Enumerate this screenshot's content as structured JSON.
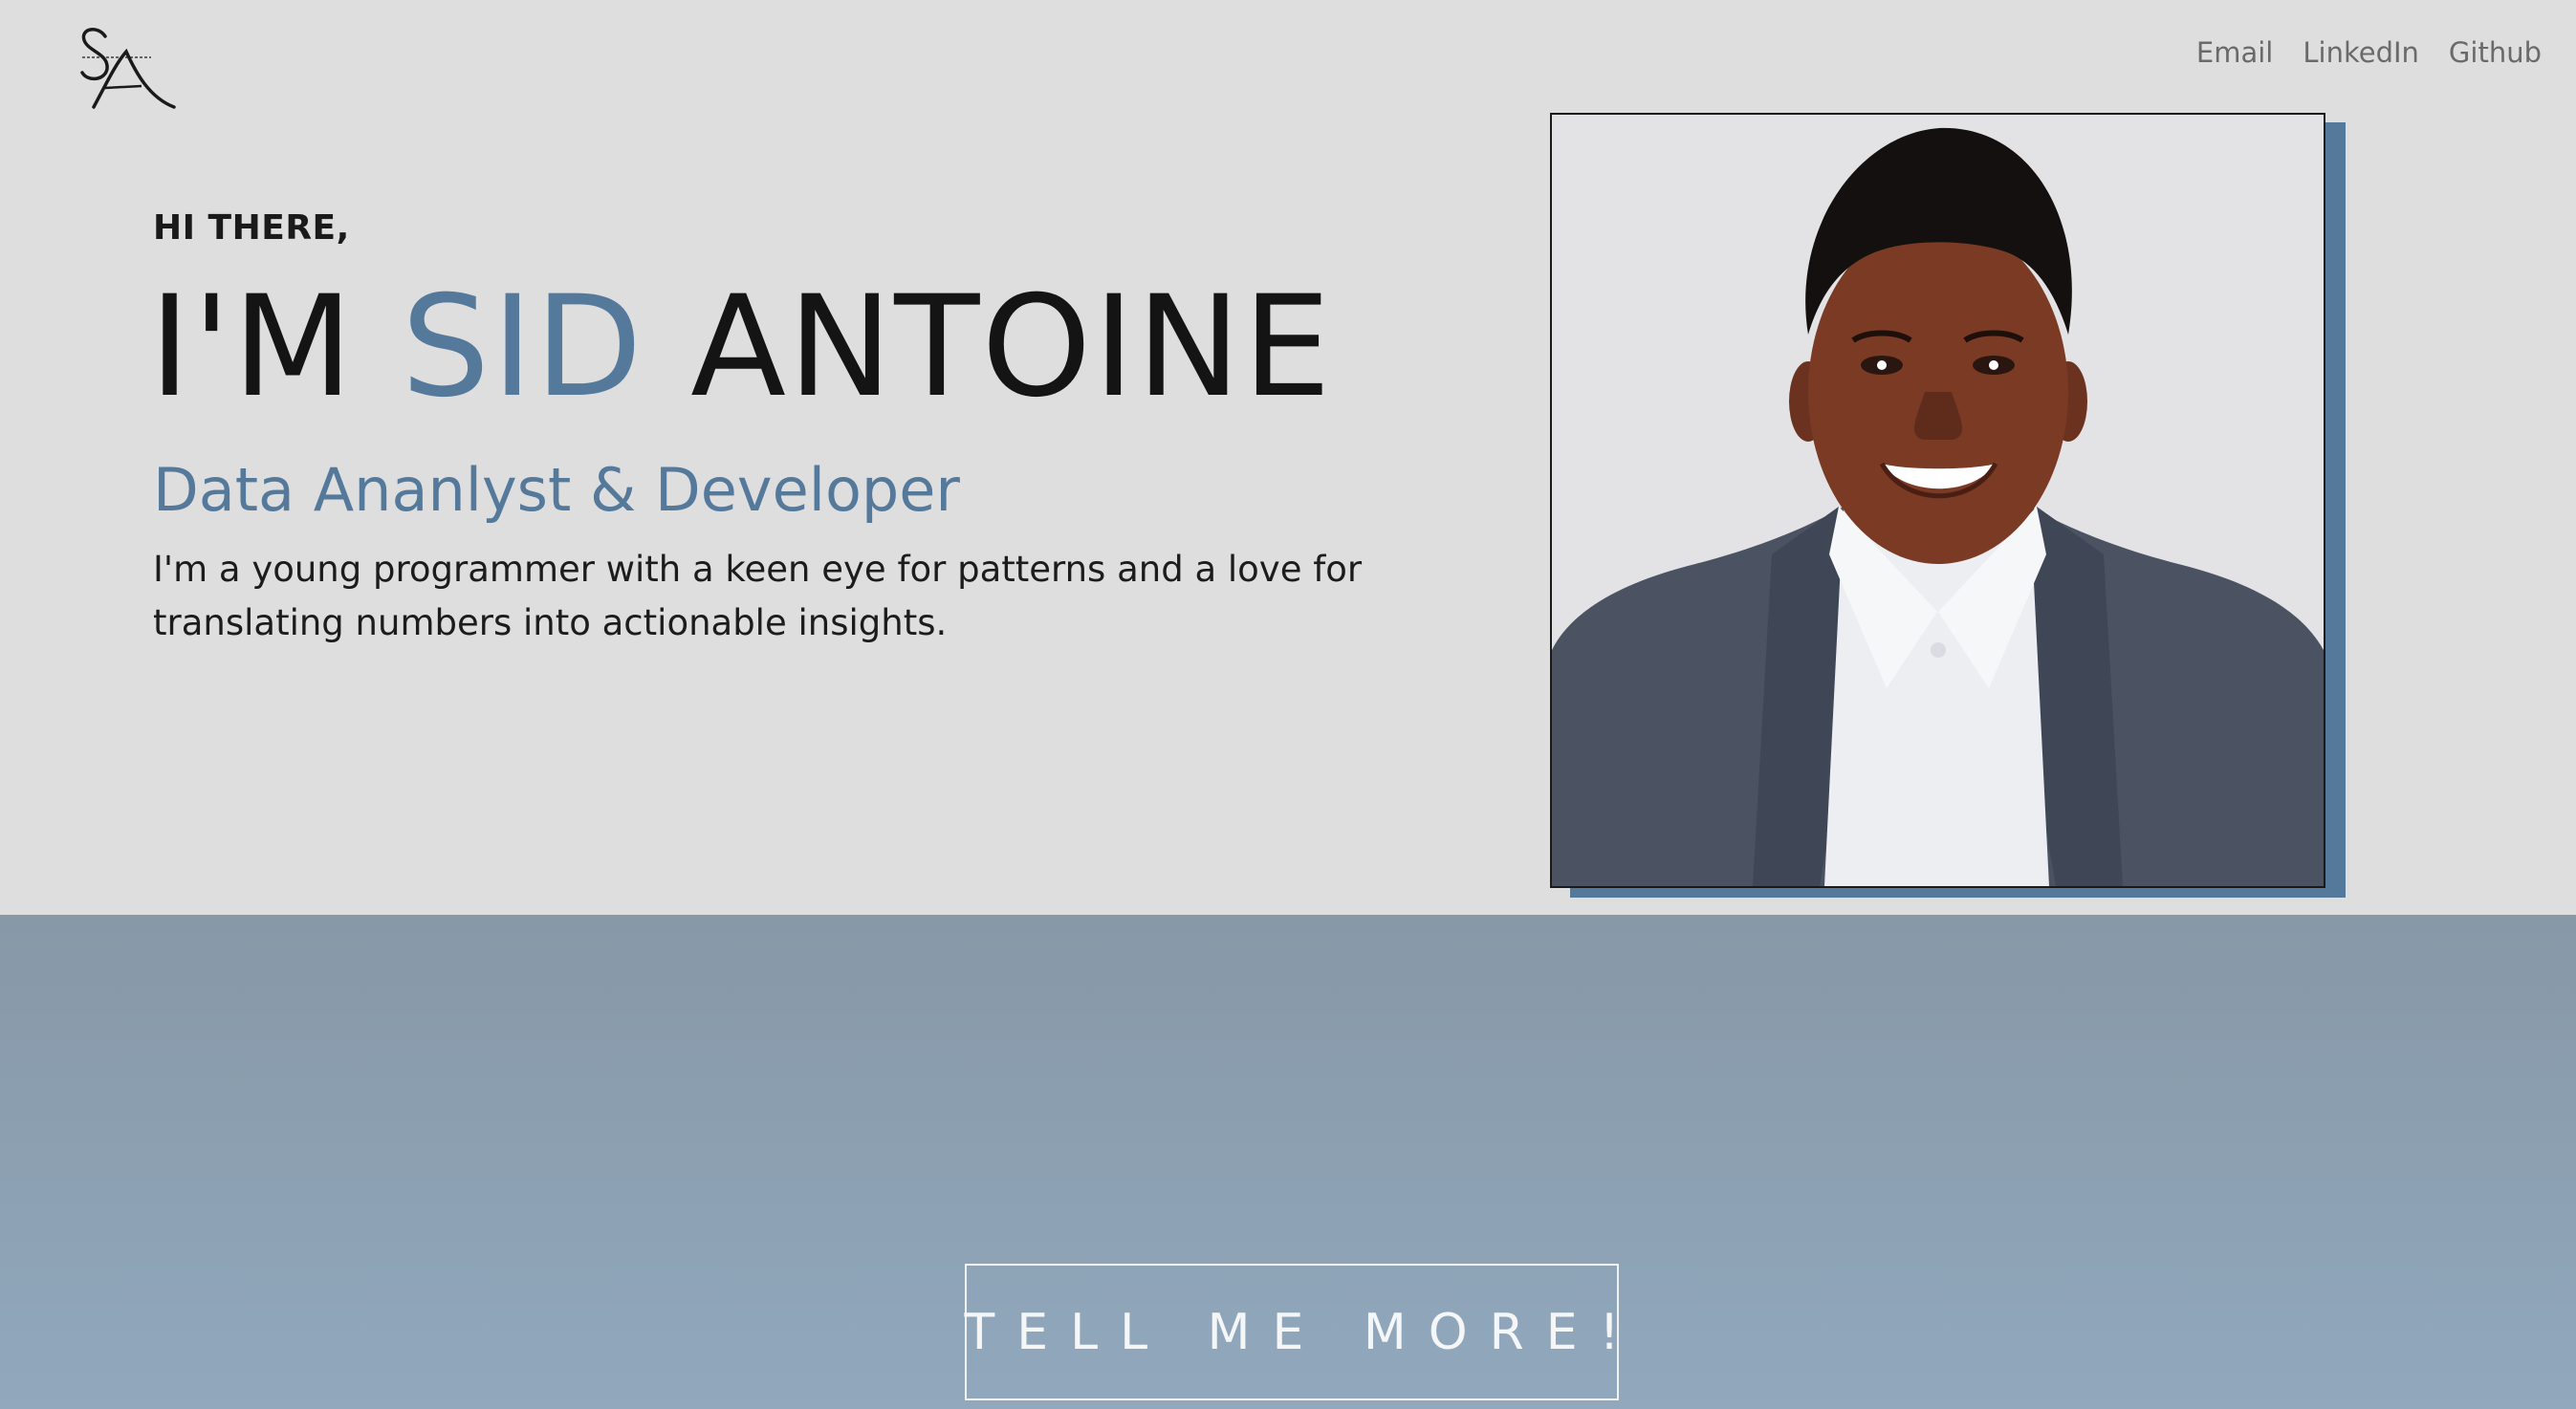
{
  "logo": {
    "icon": "sa-monogram-logo-icon"
  },
  "nav": {
    "links": [
      {
        "label": "Email"
      },
      {
        "label": "LinkedIn"
      },
      {
        "label": "Github"
      }
    ]
  },
  "hero": {
    "greeting": "HI THERE,",
    "name_prefix": "I'M ",
    "name_accent": "SID",
    "name_suffix": " ANTOINE",
    "role": "Data Ananlyst & Developer",
    "bio": "I'm a young programmer with a keen eye for patterns and a love for translating numbers into actionable insights.",
    "photo_icon": "portrait-photo"
  },
  "cta": {
    "label": "TELL ME MORE!"
  },
  "colors": {
    "accent": "#55799b",
    "background": "#dedede",
    "lower_top": "#8798a7",
    "lower_bottom": "#91a8bd"
  }
}
